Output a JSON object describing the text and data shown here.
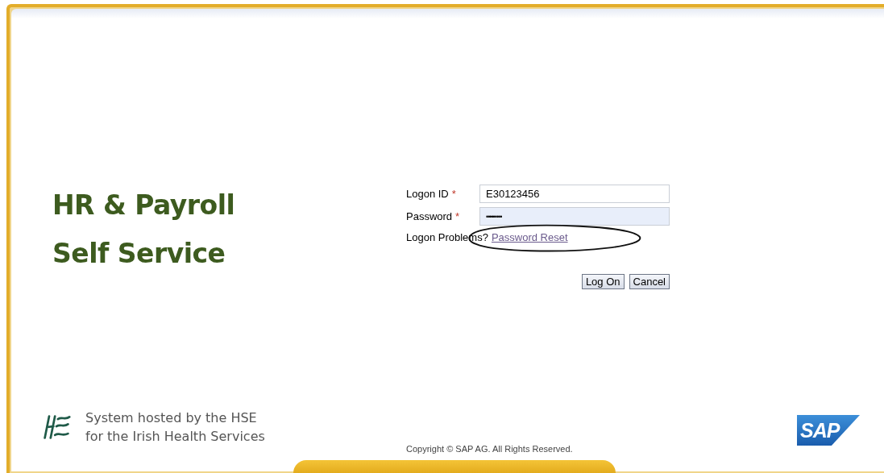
{
  "title_lines": [
    "HR & Payroll",
    "Self Service"
  ],
  "form": {
    "fields": [
      {
        "label": "Logon ID",
        "required_mark": "*",
        "value": "E30123456",
        "kind": "text",
        "focused": false
      },
      {
        "label": "Password",
        "required_mark": "*",
        "value": "•••••••••",
        "kind": "password",
        "focused": true
      }
    ],
    "problems_text": "Logon Problems?",
    "reset_link": "Password Reset",
    "buttons": [
      "Log On",
      "Cancel"
    ]
  },
  "footer": {
    "hosted_lines": [
      "System hosted by the HSE",
      "for the Irish Health Services"
    ],
    "copyright": "Copyright © SAP AG. All Rights Reserved.",
    "sap_logo": "SAP"
  }
}
